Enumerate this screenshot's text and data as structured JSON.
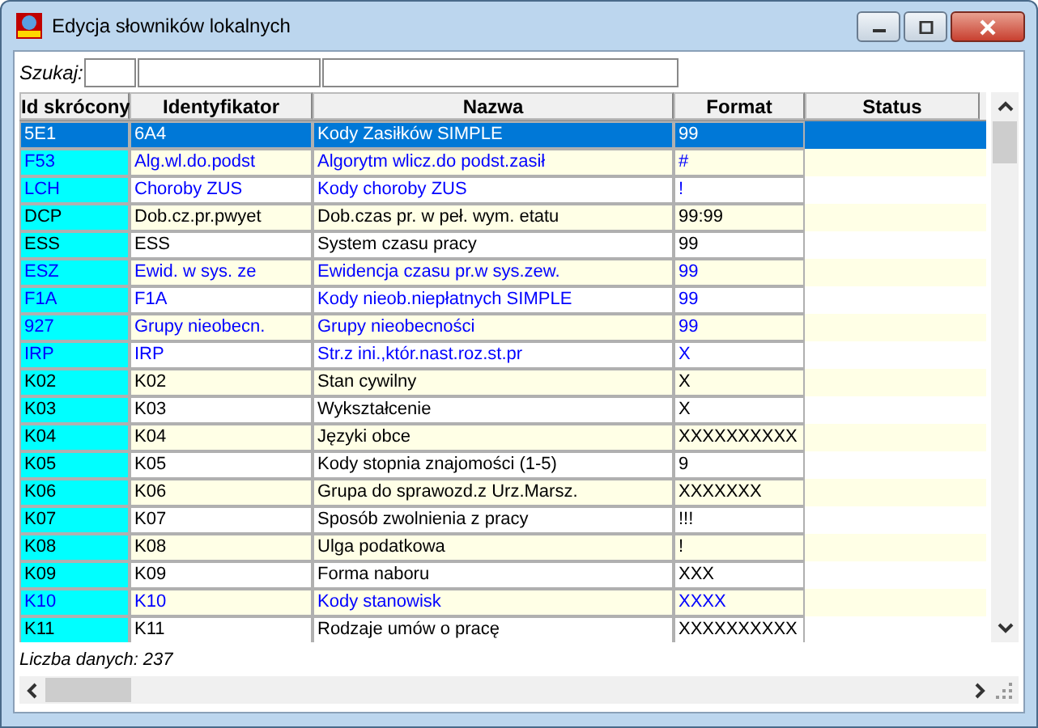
{
  "window": {
    "title": "Edycja słowników lokalnych"
  },
  "search": {
    "label": "Szukaj:"
  },
  "table": {
    "columns": [
      "Id skrócony",
      "Identyfikator",
      "Nazwa",
      "Format",
      "Status"
    ],
    "rows": [
      {
        "id": "5E1",
        "ident": "6A4",
        "name": "Kody Zasiłków SIMPLE",
        "format": "99",
        "selected": true
      },
      {
        "id": "F53",
        "ident": "Alg.wl.do.podst",
        "name": "Algorytm wlicz.do podst.zasił",
        "format": "#",
        "color": "#0000ff",
        "selected": false
      },
      {
        "id": "LCH",
        "ident": "Choroby ZUS",
        "name": "Kody choroby ZUS",
        "format": "!",
        "color": "#0000ff",
        "selected": false
      },
      {
        "id": "DCP",
        "ident": "Dob.cz.pr.pwyet",
        "name": "Dob.czas pr. w peł. wym. etatu",
        "format": "99:99",
        "color": "#000000",
        "selected": false
      },
      {
        "id": "ESS",
        "ident": "ESS",
        "name": "System czasu pracy",
        "format": "99",
        "color": "#000000",
        "selected": false
      },
      {
        "id": "ESZ",
        "ident": "Ewid. w sys. ze",
        "name": "Ewidencja czasu pr.w sys.zew.",
        "format": "99",
        "color": "#0000ff",
        "selected": false
      },
      {
        "id": "F1A",
        "ident": "F1A",
        "name": "Kody nieob.niepłatnych SIMPLE",
        "format": "99",
        "color": "#0000ff",
        "selected": false
      },
      {
        "id": "927",
        "ident": "Grupy nieobecn.",
        "name": "Grupy nieobecności",
        "format": "99",
        "color": "#0000ff",
        "selected": false
      },
      {
        "id": "IRP",
        "ident": "IRP",
        "name": "Str.z ini.,któr.nast.roz.st.pr",
        "format": "X",
        "color": "#0000ff",
        "selected": false
      },
      {
        "id": "K02",
        "ident": "K02",
        "name": "Stan cywilny",
        "format": "X",
        "color": "#000000",
        "selected": false
      },
      {
        "id": "K03",
        "ident": "K03",
        "name": "Wykształcenie",
        "format": "X",
        "color": "#000000",
        "selected": false
      },
      {
        "id": "K04",
        "ident": "K04",
        "name": "Języki obce",
        "format": "XXXXXXXXXX",
        "color": "#000000",
        "selected": false
      },
      {
        "id": "K05",
        "ident": "K05",
        "name": "Kody stopnia znajomości (1-5)",
        "format": "9",
        "color": "#000000",
        "selected": false
      },
      {
        "id": "K06",
        "ident": "K06",
        "name": "Grupa do sprawozd.z Urz.Marsz.",
        "format": "XXXXXXX",
        "color": "#000000",
        "selected": false
      },
      {
        "id": "K07",
        "ident": "K07",
        "name": "Sposób zwolnienia z pracy",
        "format": "!!!",
        "color": "#000000",
        "selected": false
      },
      {
        "id": "K08",
        "ident": "K08",
        "name": "Ulga podatkowa",
        "format": "!",
        "color": "#000000",
        "selected": false
      },
      {
        "id": "K09",
        "ident": "K09",
        "name": "Forma naboru",
        "format": "XXX",
        "color": "#000000",
        "selected": false
      },
      {
        "id": "K10",
        "ident": "K10",
        "name": "Kody stanowisk",
        "format": "XXXX",
        "color": "#0000ff",
        "selected": false
      },
      {
        "id": "K11",
        "ident": "K11",
        "name": "Rodzaje umów o pracę",
        "format": "XXXXXXXXXX",
        "color": "#000000",
        "selected": false
      }
    ]
  },
  "status_bar": {
    "text": "Liczba danych: 237"
  }
}
